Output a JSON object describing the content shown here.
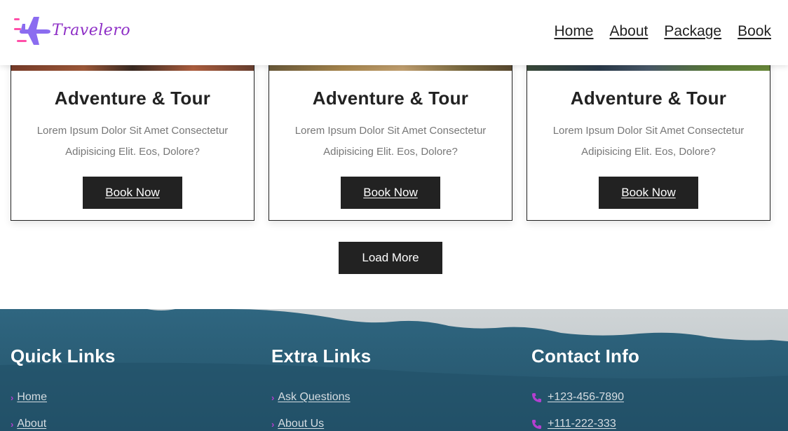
{
  "brand": {
    "name": "Travelero",
    "color": "#8e2fc6",
    "icon": "airplane-icon"
  },
  "nav": {
    "items": [
      "Home",
      "About",
      "Package",
      "Book"
    ]
  },
  "cards": [
    {
      "title": "Adventure & Tour",
      "text": "Lorem Ipsum Dolor Sit Amet Consectetur Adipisicing Elit. Eos, Dolore?",
      "button": "Book Now"
    },
    {
      "title": "Adventure & Tour",
      "text": "Lorem Ipsum Dolor Sit Amet Consectetur Adipisicing Elit. Eos, Dolore?",
      "button": "Book Now"
    },
    {
      "title": "Adventure & Tour",
      "text": "Lorem Ipsum Dolor Sit Amet Consectetur Adipisicing Elit. Eos, Dolore?",
      "button": "Book Now"
    }
  ],
  "load_more": "Load More",
  "footer": {
    "quick_links": {
      "title": "Quick Links",
      "items": [
        "Home",
        "About"
      ]
    },
    "extra_links": {
      "title": "Extra Links",
      "items": [
        "Ask Questions",
        "About Us"
      ]
    },
    "contact": {
      "title": "Contact Info",
      "items": [
        " +123-456-7890",
        " +111-222-333"
      ]
    }
  },
  "colors": {
    "accent": "#b43fd0",
    "dark": "#222222",
    "footer": "#24586e"
  }
}
